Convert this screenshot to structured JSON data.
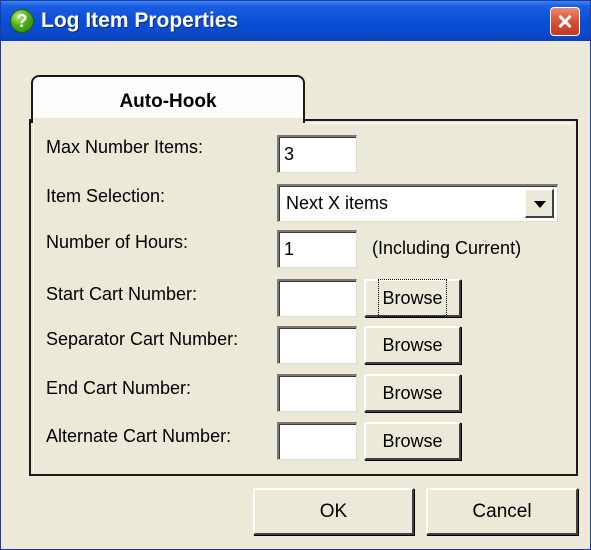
{
  "window": {
    "title": "Log Item Properties",
    "help_icon": "?",
    "close_icon": "close-icon"
  },
  "tabs": [
    {
      "label": "Auto-Hook",
      "selected": true
    }
  ],
  "form": {
    "max_items": {
      "label": "Max Number Items:",
      "value": "3"
    },
    "item_selection": {
      "label": "Item Selection:",
      "value": "Next X items"
    },
    "hours": {
      "label": "Number of Hours:",
      "value": "1",
      "note": "(Including Current)"
    },
    "start_cart": {
      "label": "Start Cart Number:",
      "value": "",
      "button": "Browse"
    },
    "separator_cart": {
      "label": "Separator Cart Number:",
      "value": "",
      "button": "Browse"
    },
    "end_cart": {
      "label": "End Cart Number:",
      "value": "",
      "button": "Browse"
    },
    "alternate_cart": {
      "label": "Alternate Cart Number:",
      "value": "",
      "button": "Browse"
    }
  },
  "buttons": {
    "ok": "OK",
    "cancel": "Cancel"
  },
  "colors": {
    "titlebar": "#0a4fd8",
    "dialog_bg": "#ece9d8",
    "close_button": "#d9543a",
    "help_icon": "#4cae1c"
  }
}
